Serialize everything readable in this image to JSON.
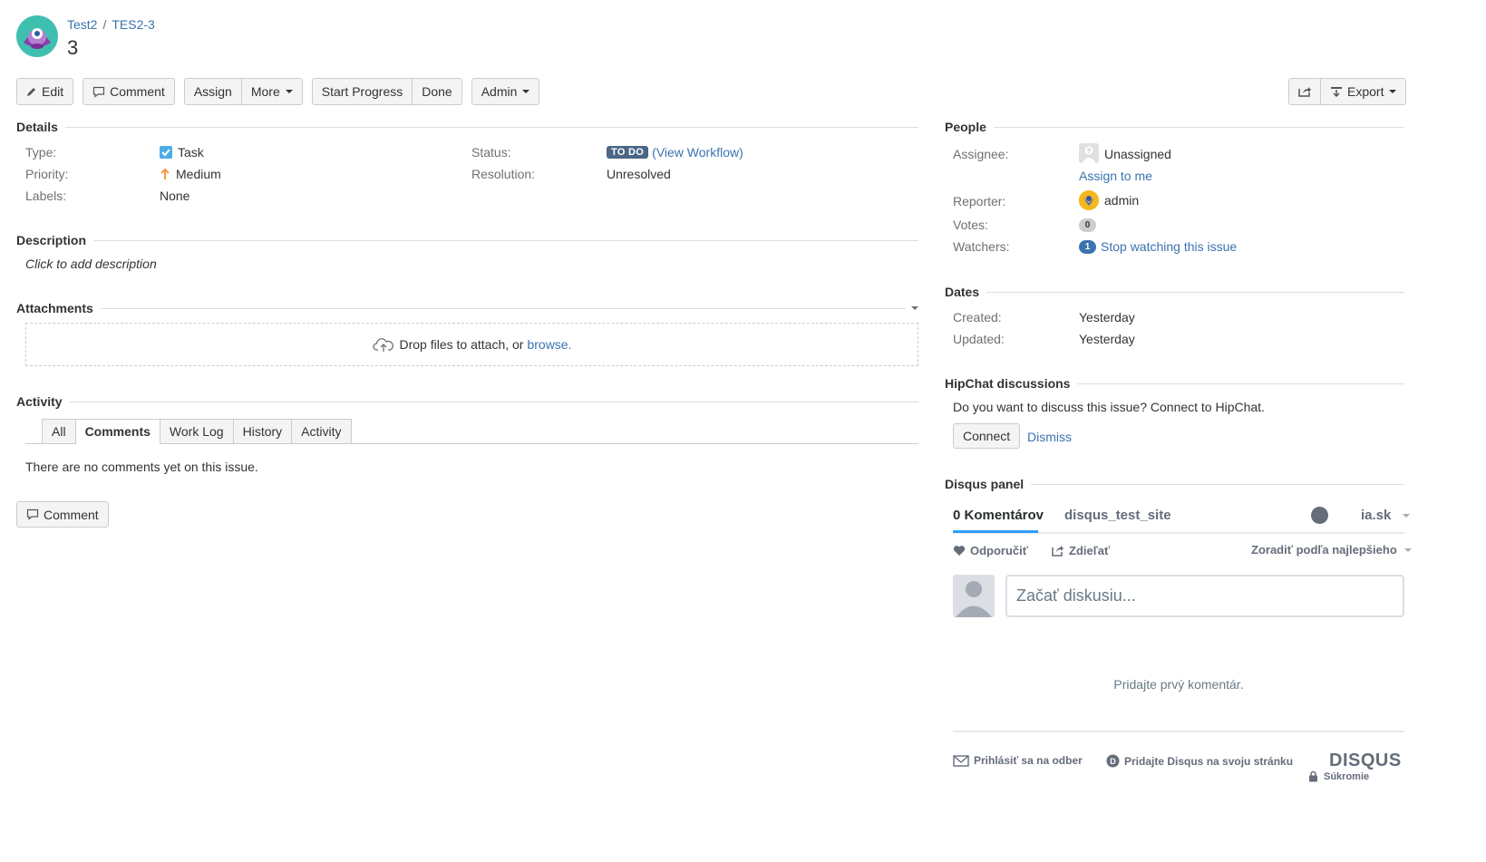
{
  "header": {
    "project": "Test2",
    "issue_key": "TES2-3",
    "separator": "/",
    "title": "3"
  },
  "toolbar": {
    "edit": "Edit",
    "comment": "Comment",
    "assign": "Assign",
    "more": "More",
    "start_progress": "Start Progress",
    "done": "Done",
    "admin": "Admin",
    "export": "Export"
  },
  "details": {
    "heading": "Details",
    "type_label": "Type:",
    "type_value": "Task",
    "priority_label": "Priority:",
    "priority_value": "Medium",
    "labels_label": "Labels:",
    "labels_value": "None",
    "status_label": "Status:",
    "status_value": "TO DO",
    "view_workflow_open": "(",
    "view_workflow": "View Workflow",
    "view_workflow_close": ")",
    "resolution_label": "Resolution:",
    "resolution_value": "Unresolved"
  },
  "description": {
    "heading": "Description",
    "placeholder": "Click to add description"
  },
  "attachments": {
    "heading": "Attachments",
    "drop_text": "Drop files to attach, or",
    "browse": "browse."
  },
  "activity": {
    "heading": "Activity",
    "tabs": [
      "All",
      "Comments",
      "Work Log",
      "History",
      "Activity"
    ],
    "active_tab": "Comments",
    "empty": "There are no comments yet on this issue.",
    "comment_button": "Comment"
  },
  "people": {
    "heading": "People",
    "assignee_label": "Assignee:",
    "assignee_value": "Unassigned",
    "assign_to_me": "Assign to me",
    "reporter_label": "Reporter:",
    "reporter_value": "admin",
    "votes_label": "Votes:",
    "votes_count": "0",
    "watchers_label": "Watchers:",
    "watchers_count": "1",
    "stop_watching": "Stop watching this issue"
  },
  "dates": {
    "heading": "Dates",
    "created_label": "Created:",
    "created_value": "Yesterday",
    "updated_label": "Updated:",
    "updated_value": "Yesterday"
  },
  "hipchat": {
    "heading": "HipChat discussions",
    "prompt": "Do you want to discuss this issue? Connect to HipChat.",
    "connect": "Connect",
    "dismiss": "Dismiss"
  },
  "disqus": {
    "heading": "Disqus panel",
    "comments_tab": "0 Komentárov",
    "site_tab": "disqus_test_site",
    "user": "ia.sk",
    "recommend": "Odporučiť",
    "share": "Zdieľať",
    "sort": "Zoradiť podľa najlepšieho",
    "input_placeholder": "Začať diskusiu...",
    "empty": "Pridajte prvý komentár.",
    "subscribe": "Prihlásiť sa na odber",
    "add_disqus": "Pridajte Disqus na svoju stránku",
    "logo": "DISQUS",
    "privacy": "Súkromie"
  },
  "colors": {
    "link": "#3b73af",
    "status_lozenge": "#4a6785",
    "priority_medium": "#f79232",
    "task_icon": "#4bade8",
    "disqus_accent": "#2e9fff"
  }
}
